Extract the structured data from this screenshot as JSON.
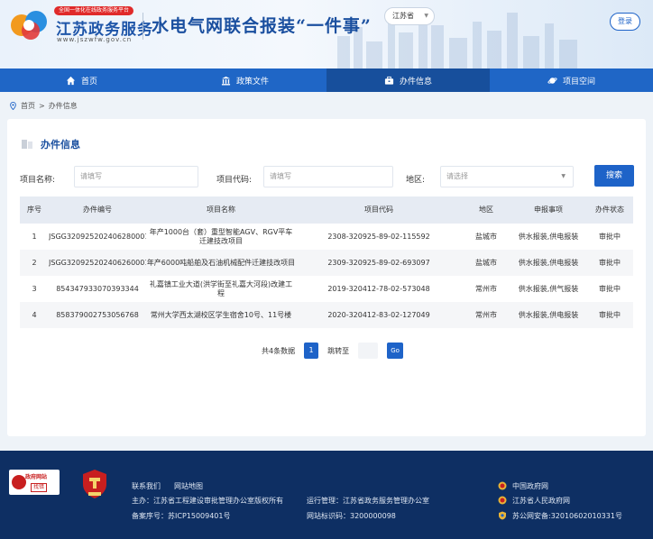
{
  "header": {
    "logo_badge": "全国一体化在线政务服务平台",
    "logo_name": "江苏政务服务",
    "logo_url": "www.jszwfw.gov.cn",
    "site_title": "水电气网联合报装“一件事”",
    "region": "江苏省",
    "login_label": "登录"
  },
  "nav": [
    {
      "label": "首页",
      "icon": "home-icon"
    },
    {
      "label": "政策文件",
      "icon": "building-icon"
    },
    {
      "label": "办件信息",
      "icon": "briefcase-icon"
    },
    {
      "label": "项目空间",
      "icon": "planet-icon"
    }
  ],
  "breadcrumb": {
    "home": "首页",
    "separator": ">",
    "current": "办件信息"
  },
  "panel": {
    "title": "办件信息",
    "filters": {
      "name_label": "项目名称:",
      "name_placeholder": "请填写",
      "code_label": "项目代码:",
      "code_placeholder": "请填写",
      "region_label": "地区:",
      "region_placeholder": "请选择",
      "search_label": "搜索"
    },
    "columns": [
      "序号",
      "办件编号",
      "项目名称",
      "项目代码",
      "地区",
      "申报事项",
      "办件状态"
    ],
    "rows": [
      {
        "no": "1",
        "id": "JSGG320925202406280001",
        "name": "年产1000台（套）重型智能AGV、RGV平车迁建技改项目",
        "code": "2308-320925-89-02-115592",
        "region": "盐城市",
        "items": "供水报装,供电报装",
        "status": "审批中"
      },
      {
        "no": "2",
        "id": "JSGG320925202406260001",
        "name": "年产6000吨船舶及石油机械配件迁建技改项目",
        "code": "2309-320925-89-02-693097",
        "region": "盐城市",
        "items": "供水报装,供电报装",
        "status": "审批中"
      },
      {
        "no": "3",
        "id": "854347933070393344",
        "name": "礼嘉镇工业大道(洪学街至礼嘉大河段)改建工程",
        "code": "2019-320412-78-02-573048",
        "region": "常州市",
        "items": "供水报装,供气报装",
        "status": "审批中"
      },
      {
        "no": "4",
        "id": "858379002753056768",
        "name": "常州大学西太湖校区学生宿舍10号、11号楼",
        "code": "2020-320412-83-02-127049",
        "region": "常州市",
        "items": "供水报装,供电报装",
        "status": "审批中"
      }
    ],
    "pager": {
      "total": "共4条数据",
      "page": "1",
      "jump_label": "跳转至",
      "go": "Go"
    }
  },
  "footer": {
    "gov_badge_top": "政府网站",
    "gov_badge_bottom": "找错",
    "party_badge": "党政机关",
    "contact": "联系我们",
    "sitemap": "网站地图",
    "sponsor": "主办：江苏省工程建设审批管理办公室版权所有",
    "operator": "运行管理：江苏省政务服务管理办公室",
    "icp": "备案序号：苏ICP15009401号",
    "site_code": "网站标识码：3200000098",
    "link1": "中国政府网",
    "link2": "江苏省人民政府网",
    "security": "苏公网安备:32010602010331号"
  },
  "colors": {
    "primary": "#1e63c8",
    "nav": "#1f66c6",
    "footer": "#0e2f63",
    "accent_red": "#e02a2a"
  }
}
